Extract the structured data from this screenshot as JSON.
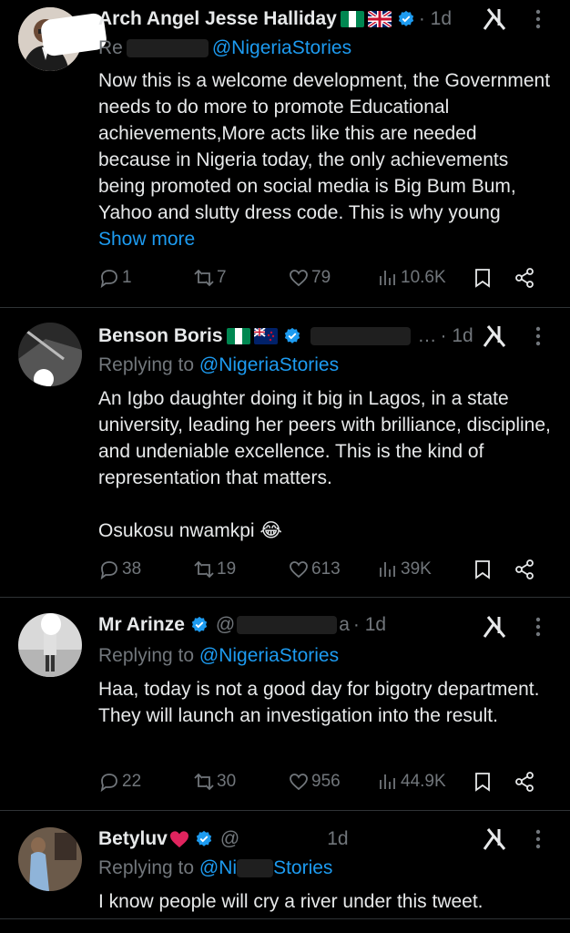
{
  "replies": [
    {
      "name": "Arch Angel Jesse Halliday",
      "flags": [
        "nigeria-flag",
        "uk-flag"
      ],
      "time": "· 1d",
      "replying_prefix": "Re",
      "mention": "@NigeriaStories",
      "body": "Now this is a welcome development, the Government needs to do more to promote Educational achievements,More acts like this are needed because in Nigeria today, the only achievements being promoted on social media is Big Bum Bum, Yahoo and slutty dress code. This is why young",
      "show_more": "Show more",
      "replies_count": "1",
      "reposts": "7",
      "likes": "79",
      "views": "10.6K"
    },
    {
      "name": "Benson Boris",
      "flags": [
        "nigeria-flag",
        "new-zealand-flag"
      ],
      "handle": "…",
      "time": "· 1d",
      "replying_prefix": "Replying to",
      "mention": "@NigeriaStories",
      "body": "An Igbo daughter doing it big in Lagos, in a state university, leading her peers with brilliance, discipline, and undeniable excellence. This is the kind of representation that matters.",
      "body2": "Osukosu nwamkpi 😂",
      "replies_count": "38",
      "reposts": "19",
      "likes": "613",
      "views": "39K"
    },
    {
      "name": "Mr Arinze",
      "handle": "@",
      "handle_end": "a",
      "time": "· 1d",
      "replying_prefix": "Replying to",
      "mention": "@NigeriaStories",
      "body": "Haa, today is not a good day for bigotry department. They will launch an investigation into the result.",
      "replies_count": "22",
      "reposts": "30",
      "likes": "956",
      "views": "44.9K"
    },
    {
      "name": "Betyluv",
      "handle": "@",
      "time": "1d",
      "replying_prefix": "Replying to",
      "mention_start": "@Ni",
      "mention_end": "Stories",
      "body": "I know people will cry a river under this tweet."
    }
  ],
  "colors": {
    "accent": "#1d9bf0",
    "muted": "#71767b",
    "text": "#e7e9ea",
    "divider": "#2f3336",
    "heart": "#f91880"
  },
  "icons": [
    "reply-icon",
    "repost-icon",
    "like-icon",
    "views-icon",
    "bookmark-icon",
    "share-icon",
    "grok-icon",
    "more-icon",
    "verified-icon"
  ]
}
